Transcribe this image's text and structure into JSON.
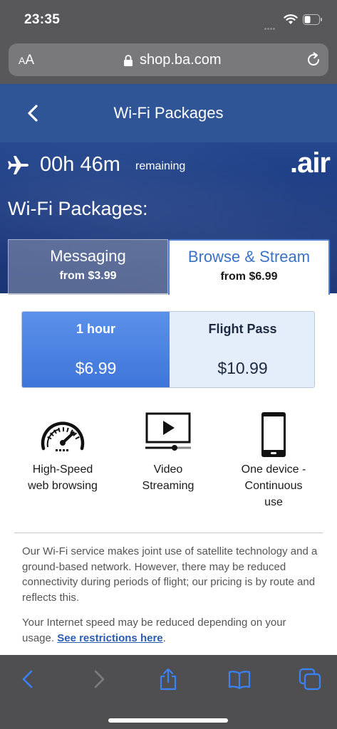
{
  "status_bar": {
    "time": "23:35"
  },
  "browser": {
    "text_size_label": "AA",
    "url": "shop.ba.com"
  },
  "header": {
    "title": "Wi-Fi Packages"
  },
  "flight": {
    "time_remaining": "00h 46m",
    "remaining_label": "remaining",
    "brand": ".air"
  },
  "heading": "Wi-Fi Packages:",
  "package_tabs": [
    {
      "name": "Messaging",
      "price": "from $3.99",
      "selected": false
    },
    {
      "name": "Browse & Stream",
      "price": "from $6.99",
      "selected": true
    }
  ],
  "durations": [
    {
      "name": "1 hour",
      "price": "$6.99",
      "selected": true
    },
    {
      "name": "Flight Pass",
      "price": "$10.99",
      "selected": false
    }
  ],
  "features": [
    {
      "icon": "speedometer-icon",
      "label_line1": "High-Speed",
      "label_line2": "web browsing",
      "label_line3": ""
    },
    {
      "icon": "video-play-icon",
      "label_line1": "Video",
      "label_line2": "Streaming",
      "label_line3": ""
    },
    {
      "icon": "phone-device-icon",
      "label_line1": "One device -",
      "label_line2": "Continuous",
      "label_line3": "use"
    }
  ],
  "disclaimer": {
    "paragraph1": "Our Wi-Fi service makes joint use of satellite technology and a ground-based network. However, there may be reduced connectivity during periods of flight; our pricing is by route and reflects this.",
    "paragraph2_text": "Your Internet speed may be reduced depending on your usage.",
    "restrictions_link": "See restrictions here",
    "paragraph2_end": "."
  },
  "colors": {
    "accent_blue": "#3e75d9",
    "header_blue": "#2f5597",
    "link_blue": "#2a5db0",
    "ios_blue": "#3b82f6"
  },
  "toolbar_icons": [
    "back-icon",
    "forward-icon",
    "share-icon",
    "bookmarks-icon",
    "tabs-icon"
  ]
}
